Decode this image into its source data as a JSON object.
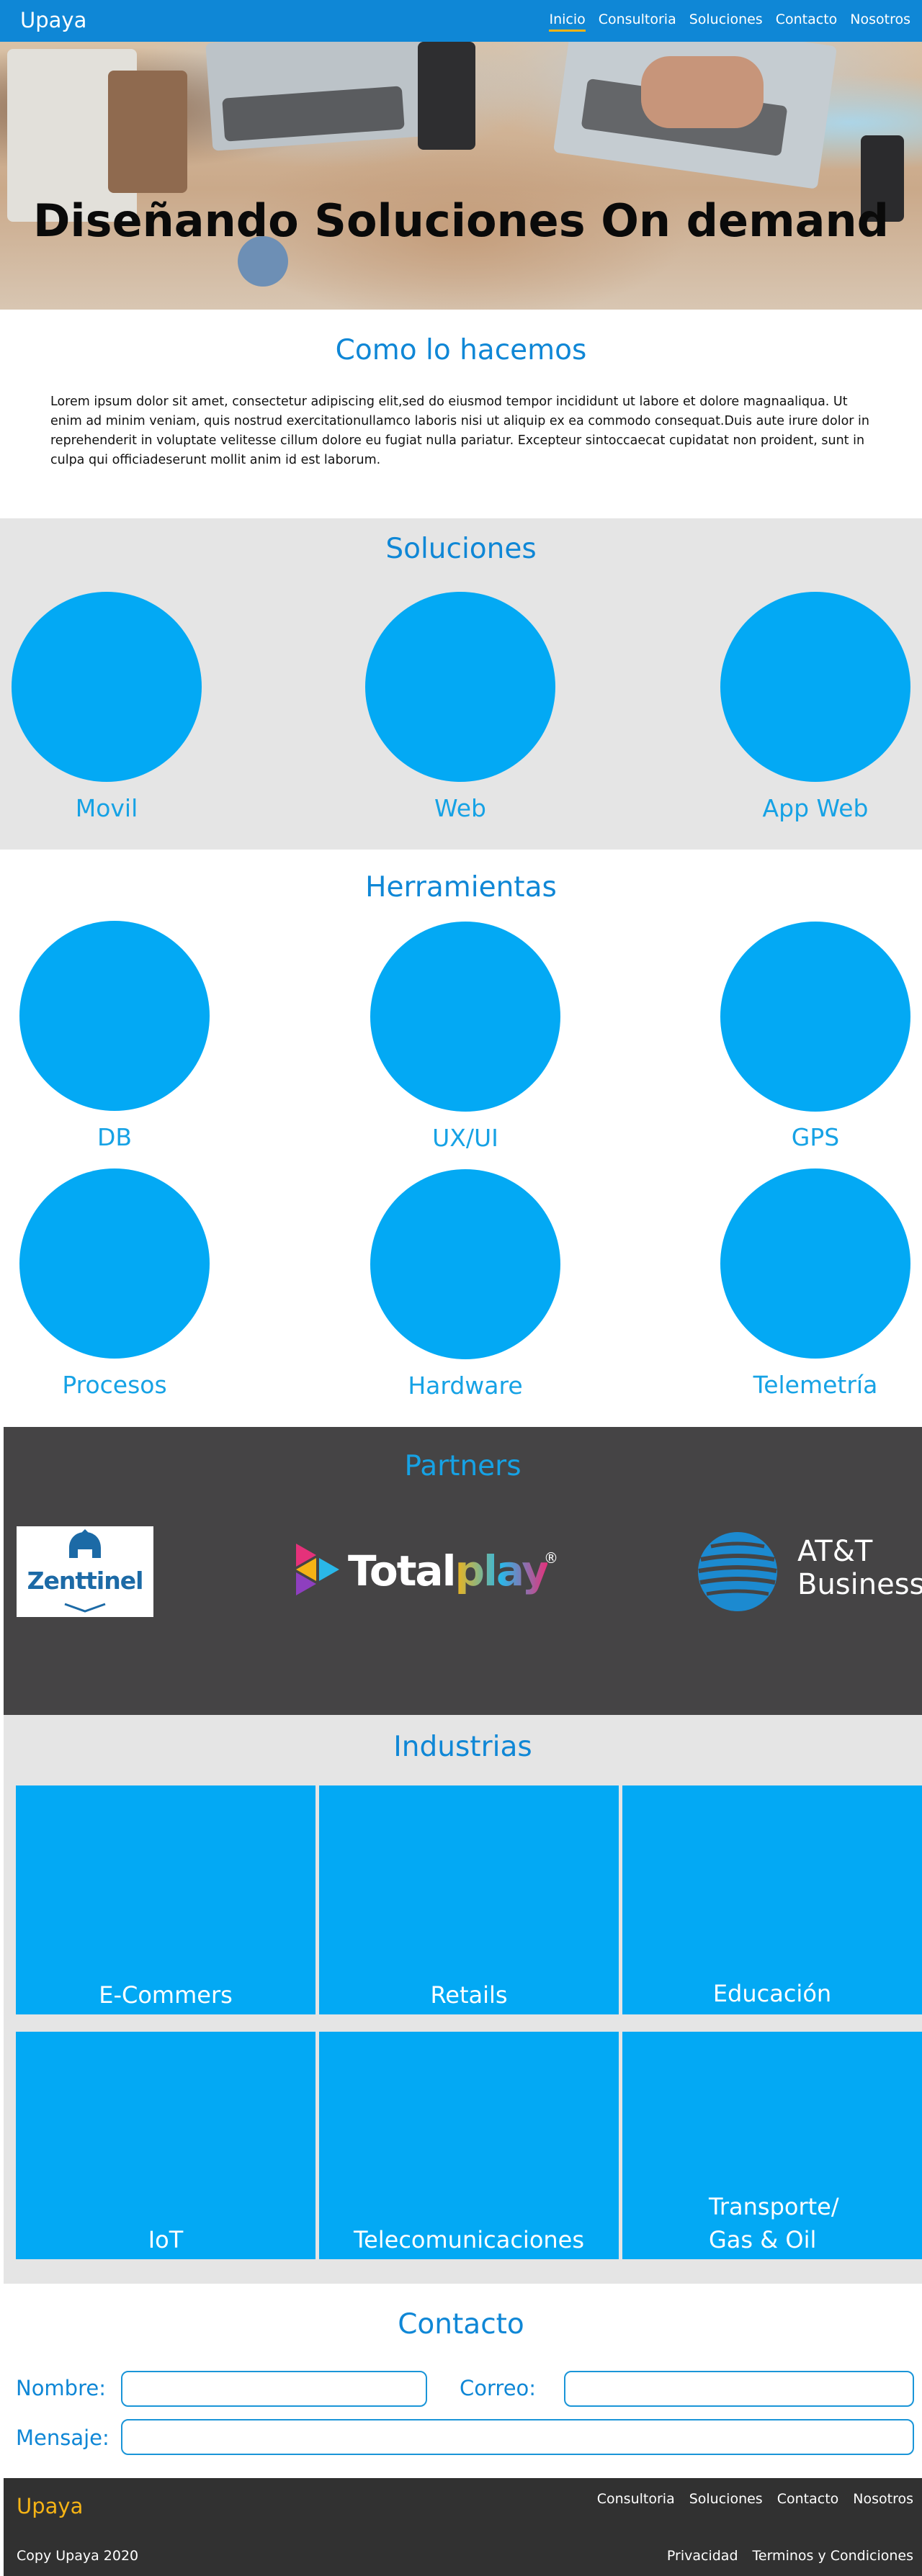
{
  "nav": {
    "brand": "Upaya",
    "links": [
      "Inicio",
      "Consultoria",
      "Soluciones",
      "Contacto",
      "Nosotros"
    ],
    "active": "Inicio"
  },
  "hero": {
    "title": "Diseñando Soluciones On demand"
  },
  "intro": {
    "title": "Como lo hacemos",
    "body": "Lorem ipsum dolor sit amet, consectetur adipiscing elit,sed do eiusmod tempor incididunt ut labore et dolore magnaaliqua. Ut enim ad minim veniam, quis nostrud exercitationullamco laboris nisi ut aliquip ex ea commodo consequat.Duis aute irure dolor in reprehenderit in voluptate velitesse cillum dolore eu fugiat nulla pariatur. Excepteur sintoccaecat cupidatat non proident, sunt in culpa qui officiadeserunt mollit anim id est laborum."
  },
  "soluciones": {
    "title": "Soluciones",
    "items": [
      "Movil",
      "Web",
      "App Web"
    ]
  },
  "herramientas": {
    "title": "Herramientas",
    "items": [
      "DB",
      "UX/UI",
      "GPS",
      "Procesos",
      "Hardware",
      "Telemetría"
    ]
  },
  "partners": {
    "title": "Partners",
    "logos": {
      "zenttinel": "Zenttinel",
      "totalplay_total": "Total",
      "totalplay_play": "play",
      "totalplay_reg": "®",
      "att_line1": "AT&T",
      "att_line2": "Business"
    }
  },
  "industrias": {
    "title": "Industrias",
    "items": [
      "E-Commers",
      "Retails",
      "Educación",
      "IoT",
      "Telecomunicaciones",
      "Transporte/",
      "Gas & Oil"
    ]
  },
  "contacto": {
    "title": "Contacto",
    "nombre_label": "Nombre:",
    "correo_label": "Correo:",
    "mensaje_label": "Mensaje:",
    "nombre_value": "",
    "correo_value": "",
    "mensaje_value": ""
  },
  "footer": {
    "brand": "Upaya",
    "links": [
      "Consultoria",
      "Soluciones",
      "Contacto",
      "Nosotros"
    ],
    "copy": "Copy Upaya 2020",
    "legal": [
      "Privacidad",
      "Terminos y Condiciones"
    ]
  },
  "colors": {
    "nav_bg": "#0f87d6",
    "accent_yellow": "#f5b315",
    "circle_blue": "#03a9f4",
    "section_gray": "#e5e5e5",
    "partners_bg": "#454445",
    "footer_bg": "#313131"
  }
}
